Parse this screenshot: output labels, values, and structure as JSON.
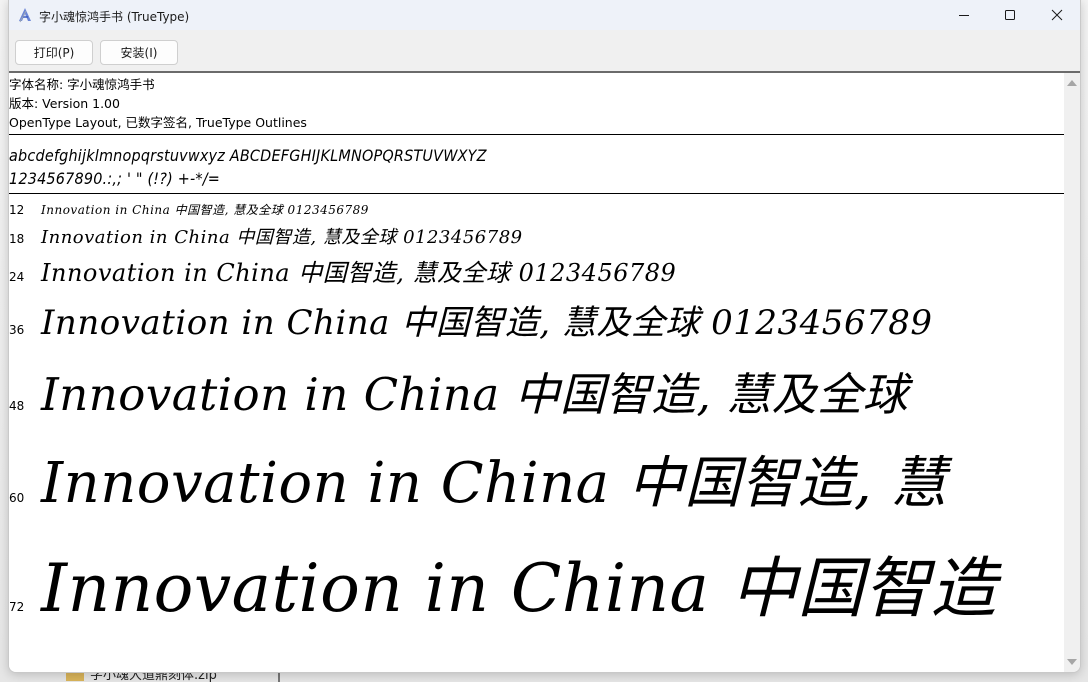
{
  "window": {
    "title": "字小魂惊鸿手书 (TrueType)",
    "icon": "font-file-icon",
    "controls": {
      "minimize": "minimize-icon",
      "maximize": "maximize-icon",
      "close": "close-icon"
    }
  },
  "toolbar": {
    "print_label": "打印(P)",
    "install_label": "安装(I)"
  },
  "font_info": {
    "name_line": "字体名称: 字小魂惊鸿手书",
    "version_line": "版本: Version 1.00",
    "features_line": "OpenType Layout, 已数字签名, TrueType Outlines"
  },
  "charset": {
    "line1": "abcdefghijklmnopqrstuvwxyz ABCDEFGHIJKLMNOPQRSTUVWXYZ",
    "line2": "1234567890.:,; ' \" (!?) +-*/="
  },
  "samples": [
    {
      "size": "12",
      "text": "Innovation in China 中国智造, 慧及全球 0123456789"
    },
    {
      "size": "18",
      "text": "Innovation in China 中国智造, 慧及全球 0123456789"
    },
    {
      "size": "24",
      "text": "Innovation in China 中国智造, 慧及全球 0123456789"
    },
    {
      "size": "36",
      "text": "Innovation in China 中国智造, 慧及全球 0123456789"
    },
    {
      "size": "48",
      "text": "Innovation in China 中国智造, 慧及全球"
    },
    {
      "size": "60",
      "text": "Innovation in China 中国智造, 慧"
    },
    {
      "size": "72",
      "text": "Innovation in China 中国智造"
    }
  ],
  "background": {
    "file_name": "字小魂大道鼎刻体.zip"
  }
}
